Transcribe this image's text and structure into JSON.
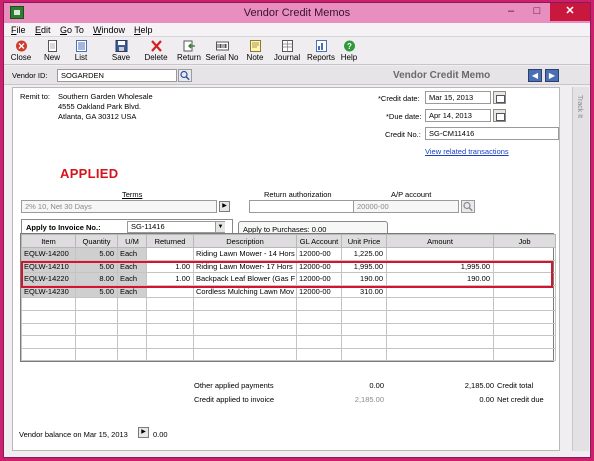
{
  "window": {
    "title": "Vendor Credit Memos",
    "minimize": "–",
    "maximize": "□",
    "close": "✕"
  },
  "menu": [
    {
      "pre": "",
      "u": "F",
      "post": "ile"
    },
    {
      "pre": "",
      "u": "E",
      "post": "dit"
    },
    {
      "pre": "",
      "u": "G",
      "post": "o To"
    },
    {
      "pre": "",
      "u": "W",
      "post": "indow"
    },
    {
      "pre": "",
      "u": "H",
      "post": "elp"
    }
  ],
  "toolbar": {
    "close": "Close",
    "new": "New",
    "list": "List",
    "save": "Save",
    "delete": "Delete",
    "return": "Return",
    "serial": "Serial No",
    "note": "Note",
    "journal": "Journal",
    "reports": "Reports",
    "help": "Help"
  },
  "vendor": {
    "label": "Vendor ID:",
    "value": "SOGARDEN",
    "header": "Vendor Credit Memo"
  },
  "remit": {
    "label": "Remit to:",
    "line1": "Southern Garden Wholesale",
    "line2": "4555 Oakland Park Blvd.",
    "line3": "Atlanta, GA 30312 USA"
  },
  "dates": {
    "credit_label": "*Credit date:",
    "credit_value": "Mar 15, 2013",
    "due_label": "*Due date:",
    "due_value": "Apr 14, 2013",
    "credit_no_label": "Credit No.:",
    "credit_no_value": "SG-CM11416",
    "link": "View related transactions"
  },
  "status": "APPLIED",
  "terms": {
    "terms_label": "Terms",
    "terms_value": "2% 10, Net 30 Days",
    "return_label": "Return authorization",
    "return_value": "",
    "ap_label": "A/P account",
    "ap_value": "20000-00"
  },
  "tabs": {
    "invoice_label": "Apply to Invoice No.:",
    "invoice_value": "SG-11416",
    "purchases_label": "Apply to Purchases: 0.00"
  },
  "grid": {
    "columns": [
      "Item",
      "Quantity",
      "U/M",
      "Returned",
      "Description",
      "GL Account",
      "Unit Price",
      "Amount",
      "Job"
    ],
    "rows": [
      {
        "item": "EQLW-14200",
        "qty": "5.00",
        "um": "Each",
        "returned": "",
        "desc": "Riding Lawn Mower - 14 Hors",
        "gl": "12000-00",
        "price": "1,225.00",
        "amount": "",
        "job": ""
      },
      {
        "item": "EQLW-14210",
        "qty": "5.00",
        "um": "Each",
        "returned": "1.00",
        "desc": "Riding Lawn Mower- 17 Hors",
        "gl": "12000-00",
        "price": "1,995.00",
        "amount": "1,995.00",
        "job": ""
      },
      {
        "item": "EQLW-14220",
        "qty": "8.00",
        "um": "Each",
        "returned": "1.00",
        "desc": "Backpack Leaf Blower (Gas F",
        "gl": "12000-00",
        "price": "190.00",
        "amount": "190.00",
        "job": ""
      },
      {
        "item": "EQLW-14230",
        "qty": "5.00",
        "um": "Each",
        "returned": "",
        "desc": "Cordless Mulching Lawn Mov",
        "gl": "12000-00",
        "price": "310.00",
        "amount": "",
        "job": ""
      }
    ],
    "empty_rows": 5
  },
  "totals": {
    "other_label": "Other applied payments",
    "other_value": "0.00",
    "credit_total_value": "2,185.00",
    "credit_total_label": "Credit total",
    "applied_label": "Credit applied to invoice",
    "applied_value": "2,185.00",
    "net_value": "0.00",
    "net_label": "Net credit due"
  },
  "balance": {
    "label": "Vendor balance on Mar 15, 2013",
    "value": "0.00"
  },
  "side_tab": "Track It",
  "colors": {
    "titlebar": "#e98fbf",
    "close_button": "#c9183d",
    "applied_text": "#d4141c",
    "highlight_border": "#d3152f",
    "link": "#1a3fbf"
  }
}
